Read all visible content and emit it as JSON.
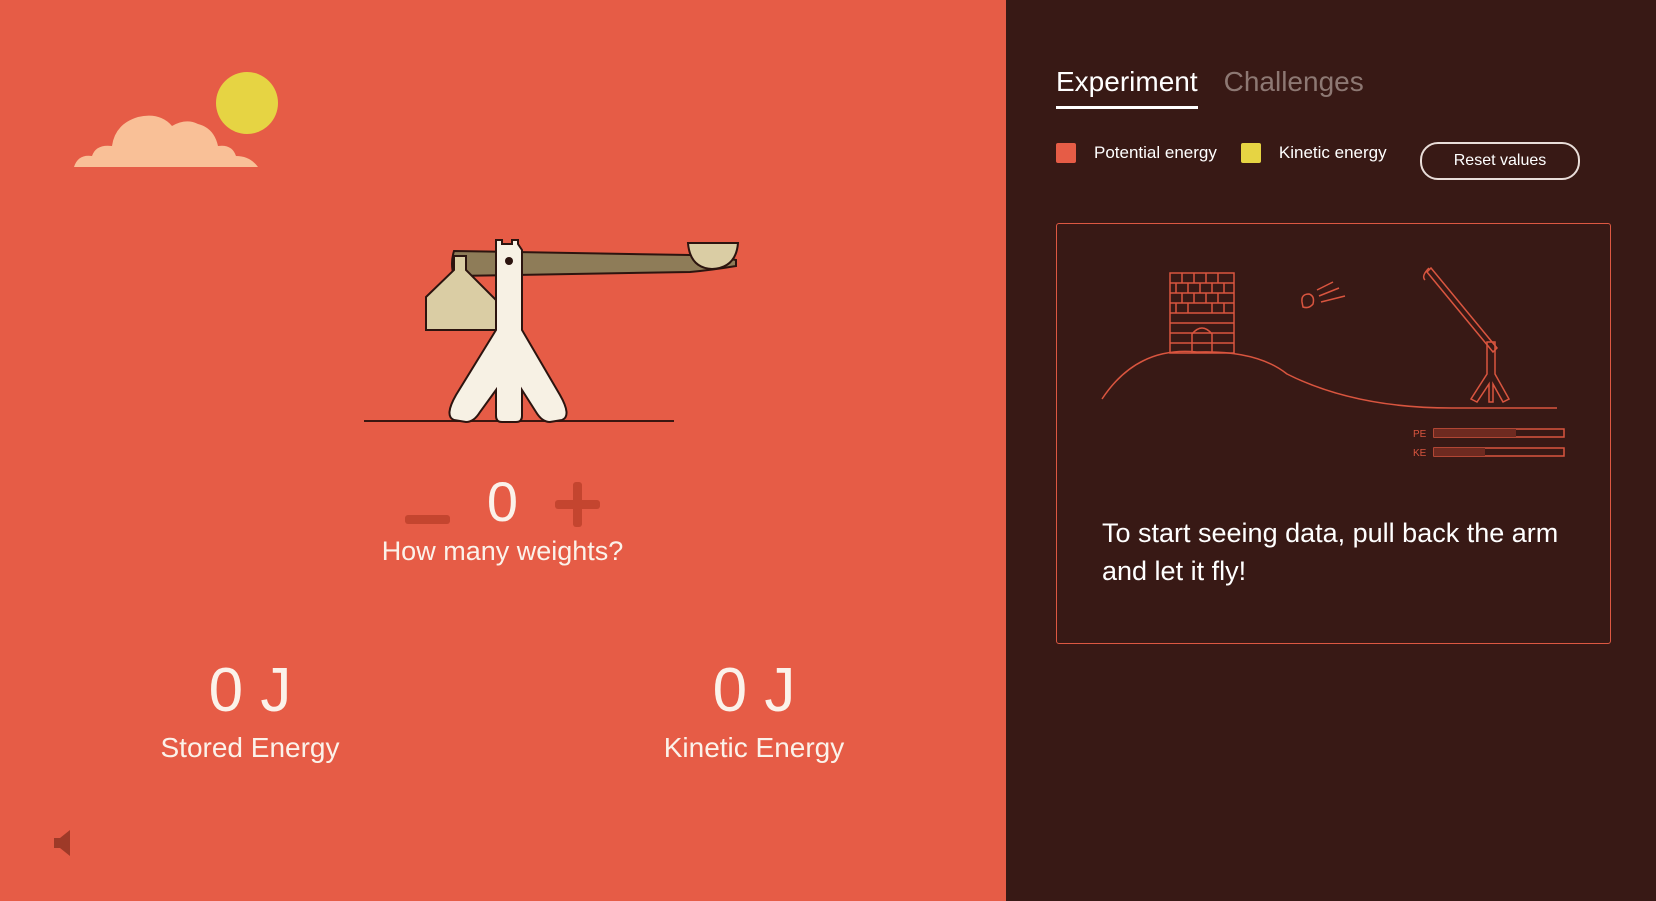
{
  "scene": {
    "weights": {
      "value": "0",
      "label": "How many weights?"
    },
    "stored_energy": {
      "value": "0 J",
      "label": "Stored Energy"
    },
    "kinetic_energy": {
      "value": "0 J",
      "label": "Kinetic Energy"
    }
  },
  "panel": {
    "tabs": [
      {
        "label": "Experiment",
        "active": true
      },
      {
        "label": "Challenges",
        "active": false
      }
    ],
    "legend": [
      {
        "label": "Potential energy",
        "color": "#e65c46"
      },
      {
        "label": "Kinetic energy",
        "color": "#e6d443"
      }
    ],
    "reset_label": "Reset values",
    "card": {
      "message": "To start seeing data, pull back the arm and let it fly!",
      "bar_labels": [
        "PE",
        "KE"
      ]
    }
  },
  "colors": {
    "scene_background": "#e65c46",
    "panel_background": "#381915",
    "sun": "#e6d443",
    "cloud": "#f9c097",
    "text_light": "#fbf2ea"
  },
  "icons": {
    "sound": "speaker-icon",
    "stepper_minus": "minus-icon",
    "stepper_plus": "plus-icon"
  }
}
